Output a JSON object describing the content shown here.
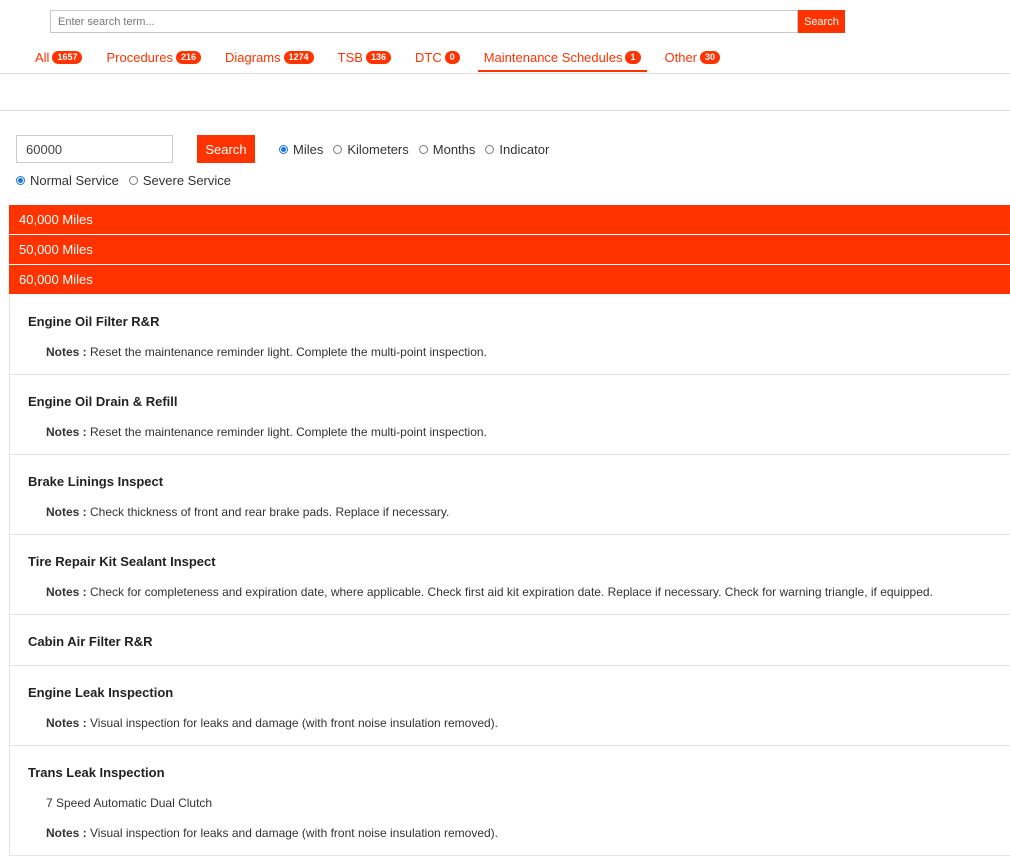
{
  "search": {
    "placeholder": "Enter search term...",
    "button_label": "Search"
  },
  "tabs": [
    {
      "label": "All",
      "count": "1657"
    },
    {
      "label": "Procedures",
      "count": "216"
    },
    {
      "label": "Diagrams",
      "count": "1274"
    },
    {
      "label": "TSB",
      "count": "136"
    },
    {
      "label": "DTC",
      "count": "0"
    },
    {
      "label": "Maintenance Schedules",
      "count": "1",
      "active": true
    },
    {
      "label": "Other",
      "count": "30"
    }
  ],
  "filter": {
    "mileage_value": "60000",
    "search_label": "Search",
    "units": [
      "Miles",
      "Kilometers",
      "Months",
      "Indicator"
    ],
    "unit_selected": "Miles",
    "service_types": [
      "Normal Service",
      "Severe Service"
    ],
    "service_selected": "Normal Service"
  },
  "intervals": [
    "40,000 Miles",
    "50,000 Miles",
    "60,000 Miles"
  ],
  "notes_label": "Notes :",
  "items": [
    {
      "title": "Engine Oil Filter R&R",
      "detail": "",
      "notes": "Reset the maintenance reminder light. Complete the multi-point inspection."
    },
    {
      "title": "Engine Oil Drain & Refill",
      "detail": "",
      "notes": "Reset the maintenance reminder light. Complete the multi-point inspection."
    },
    {
      "title": "Brake Linings Inspect",
      "detail": "",
      "notes": "Check thickness of front and rear brake pads. Replace if necessary."
    },
    {
      "title": "Tire Repair Kit Sealant Inspect",
      "detail": "",
      "notes": "Check for completeness and expiration date, where applicable. Check first aid kit expiration date. Replace if necessary. Check for warning triangle, if equipped."
    },
    {
      "title": "Cabin Air Filter R&R",
      "detail": "",
      "notes": ""
    },
    {
      "title": "Engine Leak Inspection",
      "detail": "",
      "notes": "Visual inspection for leaks and damage (with front noise insulation removed)."
    },
    {
      "title": "Trans Leak Inspection",
      "detail": "7 Speed Automatic Dual Clutch",
      "notes": "Visual inspection for leaks and damage (with front noise insulation removed)."
    }
  ],
  "colors": {
    "accent": "#ff3300",
    "radio_checked": "#1a73e8"
  }
}
